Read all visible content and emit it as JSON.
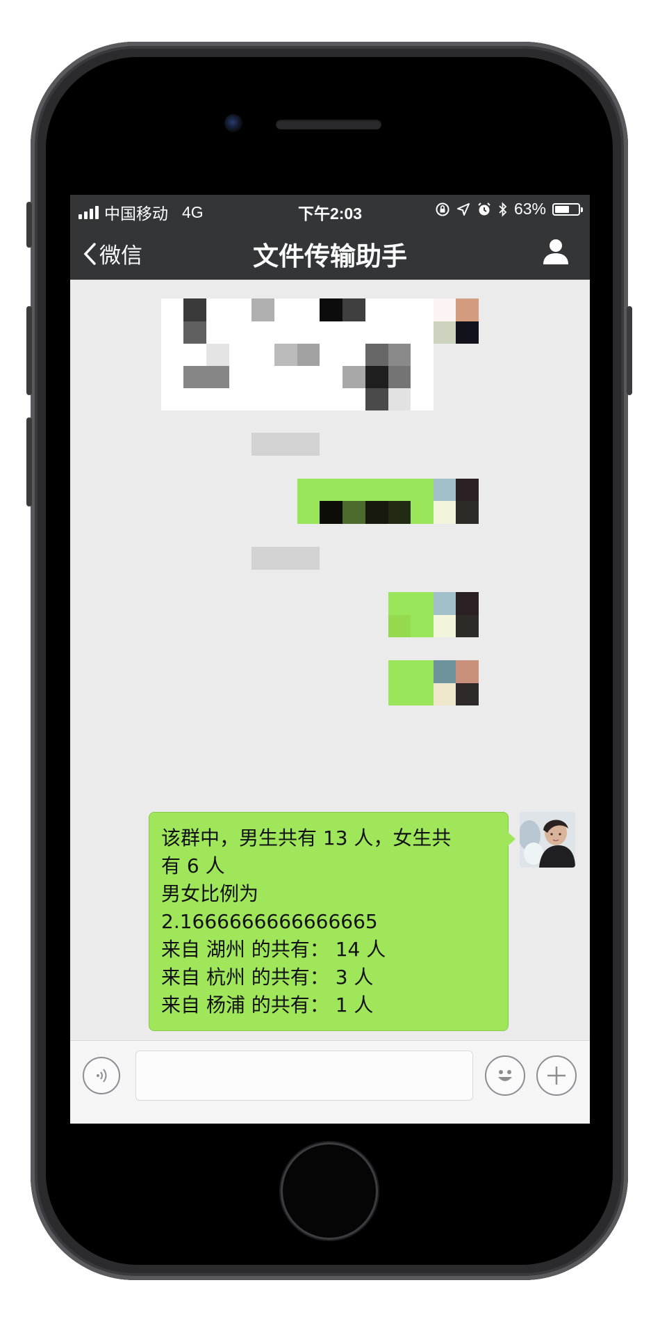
{
  "status_bar": {
    "carrier": "中国移动",
    "network": "4G",
    "time": "下午2:03",
    "battery": "63%",
    "battery_level": 0.63,
    "icons": [
      "signal-icon",
      "orientation-lock-icon",
      "location-arrow-icon",
      "alarm-icon",
      "bluetooth-icon",
      "battery-icon"
    ]
  },
  "nav": {
    "back_label": "微信",
    "title": "文件传输助手",
    "right_icon": "user-profile-icon"
  },
  "messages": {
    "text_lines": [
      "该群中，男生共有 13 人，女生共",
      "有 6 人",
      "男女比例为",
      "2.1666666666666665",
      "来自 湖州 的共有： 14 人",
      "来自 杭州 的共有： 3 人",
      "来自 杨浦 的共有： 1 人"
    ]
  },
  "input_bar": {
    "placeholder": "",
    "icons": [
      "voice-icon",
      "emoji-icon",
      "plus-icon"
    ]
  },
  "colors": {
    "nav_bg": "#343536",
    "chat_bg": "#ebebeb",
    "bubble_green": "#9fe65a",
    "phone_body": "#2b2b2d"
  }
}
